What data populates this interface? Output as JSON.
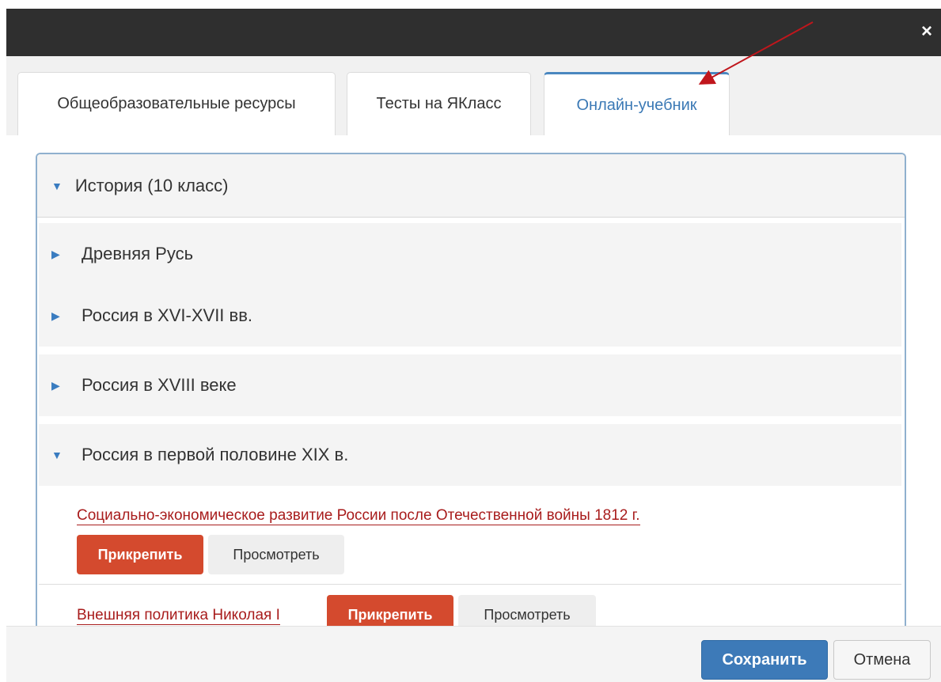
{
  "dialog": {
    "close_label": "×"
  },
  "tabs": [
    {
      "label": "Общеобразовательные ресурсы",
      "active": false
    },
    {
      "label": "Тесты на ЯКласс",
      "active": false
    },
    {
      "label": "Онлайн-учебник",
      "active": true
    }
  ],
  "tree": {
    "root": {
      "label": "История (10 класс)",
      "expanded": true
    },
    "sections": [
      {
        "label": "Древняя Русь",
        "expanded": false
      },
      {
        "label": "Россия в XVI-XVII вв.",
        "expanded": false
      },
      {
        "label": "Россия в XVIII веке",
        "expanded": false
      },
      {
        "label": "Россия в первой половине XIX в.",
        "expanded": true
      }
    ],
    "lessons": [
      {
        "title": "Социально-экономическое развитие России после Отечественной войны 1812 г.",
        "attach_label": "Прикрепить",
        "view_label": "Просмотреть"
      },
      {
        "title": "Внешняя политика Николая I",
        "attach_label": "Прикрепить",
        "view_label": "Просмотреть"
      }
    ]
  },
  "footer": {
    "save_label": "Сохранить",
    "cancel_label": "Отмена"
  },
  "icons": {
    "caret_expanded": "▼",
    "caret_collapsed": "▶"
  },
  "colors": {
    "accent": "#3d7ab8",
    "attach": "#d44a2e",
    "link": "#a81c1c",
    "annotation_arrow": "#c0161c"
  }
}
